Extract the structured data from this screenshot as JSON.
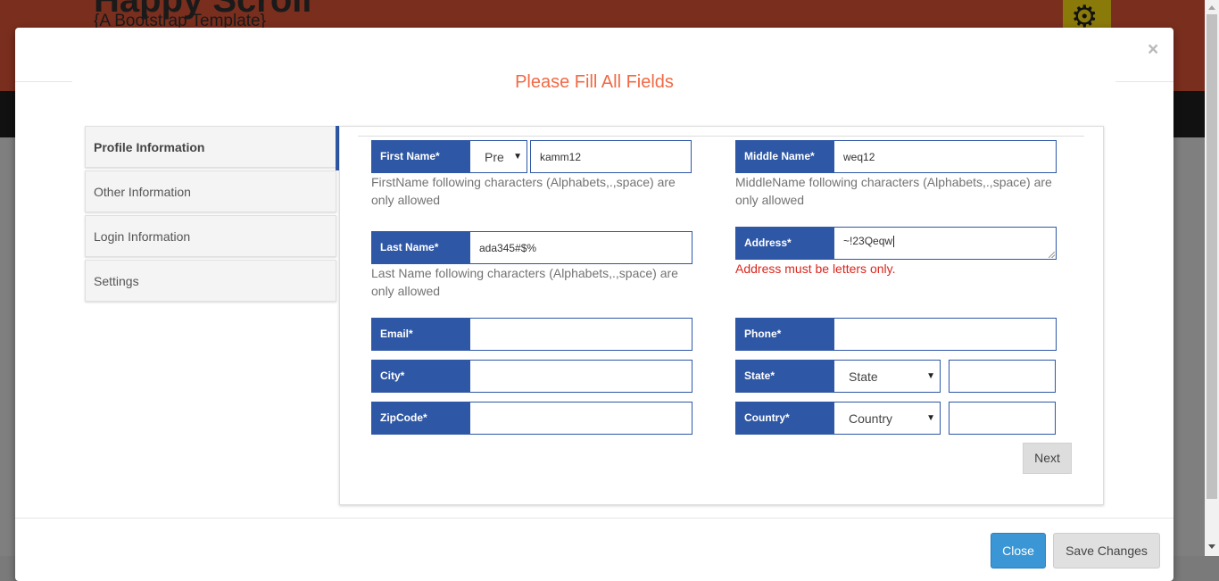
{
  "background": {
    "site_title": "Happy Scroll",
    "site_subtitle": "{A Bootstrap Template}",
    "gear_icon": "gear-icon"
  },
  "modal": {
    "close_symbol": "×",
    "title": "Please Fill All Fields",
    "title_color": "#f06a45"
  },
  "sidebar": {
    "items": [
      {
        "label": "Profile Information",
        "active": true
      },
      {
        "label": "Other Information",
        "active": false
      },
      {
        "label": "Login Information",
        "active": false
      },
      {
        "label": "Settings",
        "active": false
      }
    ]
  },
  "form": {
    "label_color": "#2e57a5",
    "first_name": {
      "label": "First Name*",
      "prefix_value": "Pre",
      "value": "kamm12",
      "help": "FirstName following characters (Alphabets,.,space) are only allowed"
    },
    "middle_name": {
      "label": "Middle Name*",
      "value": "weq12",
      "help": "MiddleName following characters (Alphabets,.,space) are only allowed"
    },
    "last_name": {
      "label": "Last Name*",
      "value": "ada345#$%",
      "help": "Last Name following characters (Alphabets,.,space) are only allowed"
    },
    "address": {
      "label": "Address*",
      "value": "~!23Qeqw",
      "error": "Address must be letters only.",
      "error_color": "#d9261c"
    },
    "email": {
      "label": "Email*",
      "value": ""
    },
    "phone": {
      "label": "Phone*",
      "value": ""
    },
    "city": {
      "label": "City*",
      "value": ""
    },
    "state": {
      "label": "State*",
      "selected": "State",
      "extra_value": ""
    },
    "zipcode": {
      "label": "ZipCode*",
      "value": ""
    },
    "country": {
      "label": "Country*",
      "selected": "Country",
      "extra_value": ""
    },
    "next_label": "Next"
  },
  "footer": {
    "close_label": "Close",
    "save_label": "Save Changes"
  }
}
